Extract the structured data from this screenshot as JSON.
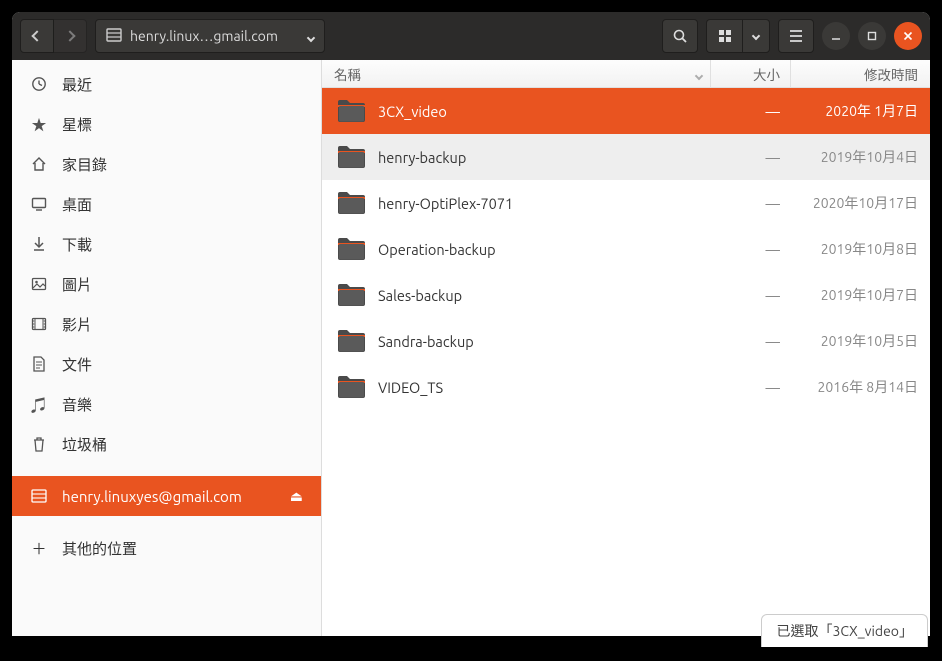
{
  "path_label": "henry.linux…gmail.com",
  "columns": {
    "name": "名稱",
    "size": "大小",
    "date": "修改時間"
  },
  "sidebar": {
    "items": [
      {
        "icon": "clock",
        "label": "最近"
      },
      {
        "icon": "star",
        "label": "星標"
      },
      {
        "icon": "home",
        "label": "家目錄"
      },
      {
        "icon": "desktop",
        "label": "桌面"
      },
      {
        "icon": "download",
        "label": "下載"
      },
      {
        "icon": "picture",
        "label": "圖片"
      },
      {
        "icon": "video",
        "label": "影片"
      },
      {
        "icon": "document",
        "label": "文件"
      },
      {
        "icon": "music",
        "label": "音樂"
      },
      {
        "icon": "trash",
        "label": "垃圾桶"
      }
    ],
    "mounted": {
      "label": "henry.linuxyes@gmail.com"
    },
    "other": {
      "label": "其他的位置"
    }
  },
  "files": [
    {
      "name": "3CX_video",
      "size": "—",
      "date": "2020年 1月7日",
      "selected": true
    },
    {
      "name": "henry-backup",
      "size": "—",
      "date": "2019年10月4日",
      "hover": true
    },
    {
      "name": "henry-OptiPlex-7071",
      "size": "—",
      "date": "2020年10月17日"
    },
    {
      "name": "Operation-backup",
      "size": "—",
      "date": "2019年10月8日"
    },
    {
      "name": "Sales-backup",
      "size": "—",
      "date": "2019年10月7日"
    },
    {
      "name": "Sandra-backup",
      "size": "—",
      "date": "2019年10月5日"
    },
    {
      "name": "VIDEO_TS",
      "size": "—",
      "date": "2016年 8月14日"
    }
  ],
  "status": "已選取「3CX_video」"
}
